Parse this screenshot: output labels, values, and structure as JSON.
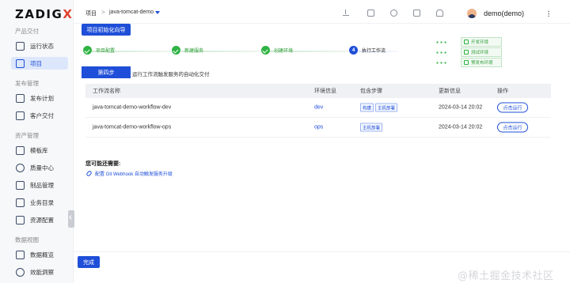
{
  "brand": {
    "logo_main": "ZADIG",
    "logo_x": "X"
  },
  "sidebar": {
    "sections": [
      {
        "title": "产品交付",
        "items": [
          {
            "label": "运行状态",
            "icon": "status-icon"
          },
          {
            "label": "项目",
            "icon": "project-icon",
            "active": true
          }
        ]
      },
      {
        "title": "发布管理",
        "items": [
          {
            "label": "发布计划",
            "icon": "release-plan-icon"
          },
          {
            "label": "客户交付",
            "icon": "customer-delivery-icon"
          }
        ]
      },
      {
        "title": "资产管理",
        "items": [
          {
            "label": "模板库",
            "icon": "template-icon"
          },
          {
            "label": "质量中心",
            "icon": "quality-icon"
          },
          {
            "label": "制品管理",
            "icon": "artifact-icon"
          },
          {
            "label": "业务目录",
            "icon": "catalog-icon"
          },
          {
            "label": "资源配置",
            "icon": "resource-icon"
          }
        ]
      },
      {
        "title": "数据视图",
        "items": [
          {
            "label": "数据概览",
            "icon": "data-overview-icon"
          },
          {
            "label": "效能洞察",
            "icon": "insight-icon"
          }
        ]
      }
    ]
  },
  "topbar": {
    "breadcrumb_root": "项目",
    "breadcrumb_sep": ">",
    "breadcrumb_project": "java-tomcat-demo",
    "user": "demo(demo)"
  },
  "wizard": {
    "title_button": "项目初始化向导",
    "steps": [
      {
        "label": "项目配置",
        "state": "done"
      },
      {
        "label": "新建服务",
        "state": "done"
      },
      {
        "label": "创建环境",
        "state": "done"
      },
      {
        "label": "执行工作流",
        "state": "current",
        "number": "4"
      }
    ],
    "envs": [
      "开发环境",
      "测试环境",
      "预发布环境"
    ],
    "step_tab": "第四步",
    "step_desc": "运行工作流触发服务的自动化交付"
  },
  "table": {
    "headers": {
      "name": "工作流名称",
      "env": "环境信息",
      "steps": "包含步骤",
      "time": "更新信息",
      "op": "操作"
    },
    "rows": [
      {
        "name": "java-tomcat-demo-workflow-dev",
        "env": "dev",
        "steps": [
          "构建",
          "主机部署"
        ],
        "time": "2024-03-14 20:02",
        "action": "点击运行"
      },
      {
        "name": "java-tomcat-demo-workflow-ops",
        "env": "ops",
        "steps": [
          "主机部署"
        ],
        "time": "2024-03-14 20:02",
        "action": "点击运行"
      }
    ]
  },
  "suggestions": {
    "title": "您可能还需要:",
    "link": "配置 Git Webhook 自动触发服务升级"
  },
  "footer": {
    "done_button": "完成"
  },
  "watermark": "@稀土掘金技术社区",
  "colors": {
    "primary": "#1f4fd8",
    "success": "#2fb344"
  }
}
